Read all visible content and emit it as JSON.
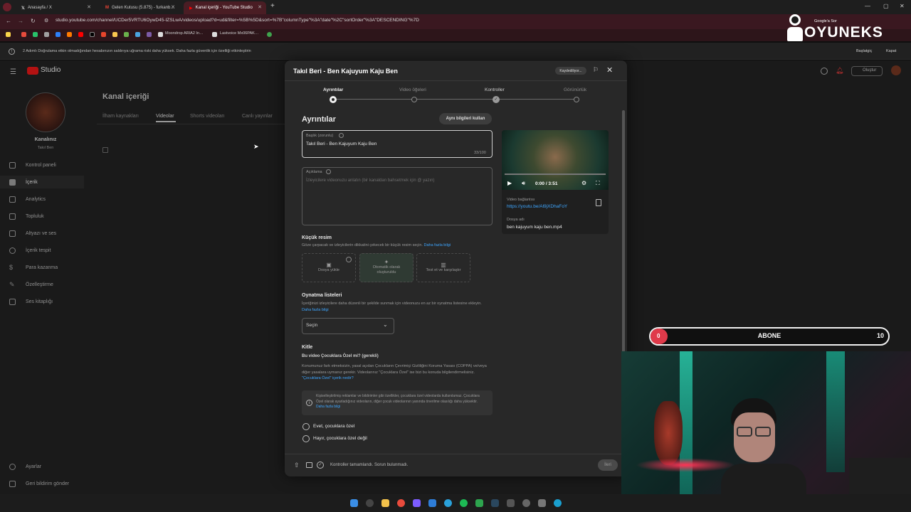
{
  "tabs": [
    {
      "title": "Anasayfa / X"
    },
    {
      "title": "Gelen Kutusu (5.875) - furkanb…"
    },
    {
      "title": "Kanal içeriği - YouTube Studio"
    }
  ],
  "address": {
    "url": "studio.youtube.com/channel/UCDer5VRTU6OywD45-IZSLwA/videos/upload?d=ud&filter=%5B%5D&sort=%7B\"columnType\"%3A\"date\"%2C\"sortOrder\"%3A\"DESCENDING\"%7D"
  },
  "bookmarks": [
    {
      "label": "Moondrop ARIA2 In…"
    },
    {
      "label": "Lastvoice Mx06PAK…"
    }
  ],
  "infobar": {
    "text": "2 Adımlı Doğrulama etkin olmadığından hesabınızın saldırıya uğrama riski daha yüksek. Daha fazla güvenlik için özelliği etkinleştirin",
    "start": "Başlatgiç",
    "close": "Kapat"
  },
  "studio": {
    "logo": "Studio",
    "channel_name": "Kanalınız",
    "channel_sub": "Takıl Ben",
    "page_title": "Kanal içeriği",
    "content_tabs": [
      "İlham kaynakları",
      "Videolar",
      "Shorts videoları",
      "Canlı yayınlar"
    ],
    "nav": [
      "Kontrol paneli",
      "İçerik",
      "Analytics",
      "Topluluk",
      "Altyazı ve ses",
      "İçerik tespit",
      "Para kazanma",
      "Özelleştirme",
      "Ses kitaplığı"
    ],
    "nav_bottom": [
      "Ayarlar",
      "Geri bildirim gönder"
    ],
    "create": "Oluştur"
  },
  "modal": {
    "title": "Takıl Beri - Ben Kajuyum Kaju Ben",
    "saving": "Kaydediliyor...",
    "steps": [
      "Ayrıntılar",
      "Video öğeleri",
      "Kontroller",
      "Görünürlük"
    ],
    "section_title": "Ayrıntılar",
    "reuse_button": "Aynı bilgileri kullan",
    "title_field": {
      "label": "Başlık (zorunlu)",
      "value": "Takıl Beri - Ben Kajuyum Kaju Ben",
      "count": "33/100"
    },
    "desc_field": {
      "label": "Açıklama",
      "placeholder": "İzleyicilere videonuzu anlatın (bir kanaldan bahsetmek için @ yazın)"
    },
    "thumb": {
      "title": "Küçük resim",
      "desc": "Göze çarpacak ve izleyicilerin dikkatini çekecek bir küçük resim seçin.",
      "link": "Daha fazla bilgi",
      "tiles": [
        "Dosya yükle",
        "Otomatik olarak oluşturuldu",
        "Test et ve karşılaştır"
      ]
    },
    "playlists": {
      "title": "Oynatma listeleri",
      "desc": "İçeriğinizi izleyicilere daha düzenli bir şekilde sunmak için videonuzu en az bir oynatma listesine ekleyin.",
      "link": "Daha fazla bilgi",
      "select": "Seçin"
    },
    "audience": {
      "title": "Kitle",
      "question": "Bu video Çocuklara Özel mi? (gerekli)",
      "desc": "Konumunuz fark etmeksizin, yasal açıdan Çocukların Çevrimiçi Gizliliğini Koruma Yasası (COPPA) ve/veya diğer yasalara uymanız gerekir. Videolarınız \"Çocuklara Özel\" ise bizi bu konuda bilgilendirmelisiniz.",
      "link": "\"Çocuklara Özel\" içerik nedir?",
      "info": "Kişiselleştirilmiş reklamlar ve bildirimler gibi özellikler, çocuklara özel videolarda kullanılamaz. Çocuklara Özel olarak ayarladığınız videoların, diğer çocuk videolarının yanında önerilme olasılığı daha yüksektir.",
      "info_link": "Daha fazla bilgi",
      "option_yes": "Evet, çocuklara özel",
      "option_no": "Hayır, çocuklara özel değil"
    },
    "preview": {
      "time": "0:00 / 3:51",
      "link_label": "Video bağlantısı",
      "link": "https://youtu.be/Al9jXDhaFoY",
      "file_label": "Dosya adı",
      "file": "ben kajuyum kaju ben.mp4"
    },
    "footer": {
      "status": "Kontroller tamamlandı. Sorun bulunmadı.",
      "next": "İleri"
    }
  },
  "overlay": {
    "brand": "OYUNEKS",
    "brand_top": "Google'a Sor",
    "goal_label": "ABONE",
    "goal_current": "0",
    "goal_target": "10"
  }
}
